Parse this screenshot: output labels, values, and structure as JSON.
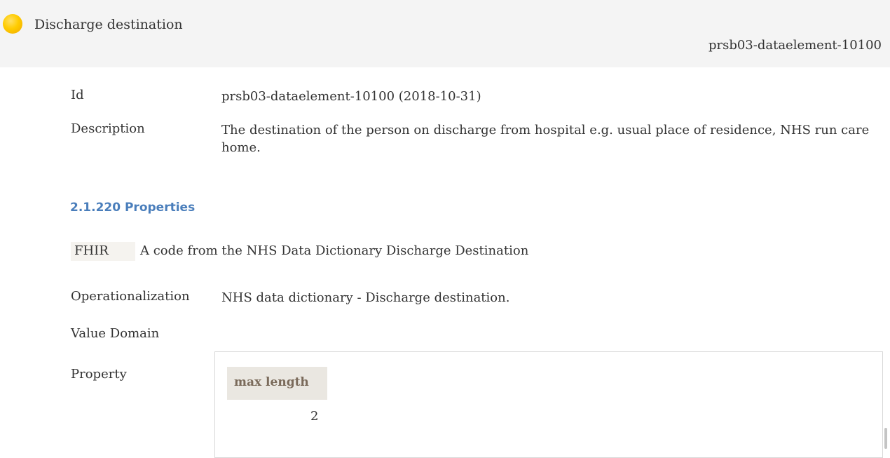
{
  "header": {
    "title": "Discharge destination",
    "id": "prsb03-dataelement-10100",
    "status_color": "#ffcc00",
    "status_icon": "status-dot-icon"
  },
  "fields": {
    "id_label": "Id",
    "id_value": "prsb03-dataelement-10100 (2018-10-31)",
    "description_label": "Description",
    "description_value": "The destination of the person on discharge from hospital e.g. usual place of residence, NHS run care home."
  },
  "properties": {
    "heading": "2.1.220 Properties",
    "fhir_label": "FHIR",
    "fhir_text": "A code from the NHS Data Dictionary Discharge Destination",
    "operationalization_label": "Operationalization",
    "operationalization_value": "NHS data dictionary - Discharge destination.",
    "value_domain_label": "Value Domain",
    "property_label": "Property",
    "property_table": {
      "column_header": "max length",
      "value": "2"
    }
  },
  "colors": {
    "heading": "#4a7ebb",
    "header_bg": "#f4f4f4",
    "table_header_bg": "#eae7e1"
  }
}
